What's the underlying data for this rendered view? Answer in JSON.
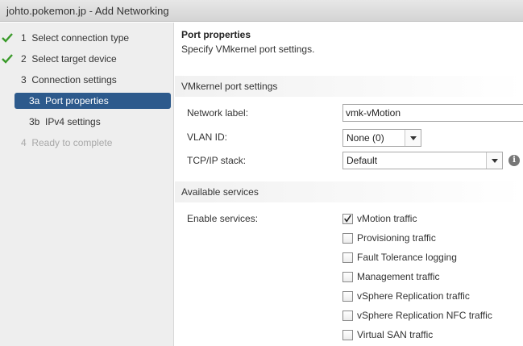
{
  "window": {
    "title": "johto.pokemon.jp - Add Networking"
  },
  "colors": {
    "active_step_bg": "#2d5a8c",
    "check_green": "#3a9a2a",
    "sidebar_bg": "#eeeeee"
  },
  "steps": [
    {
      "label": "1  Select connection type",
      "state": "completed",
      "icon": "check-icon"
    },
    {
      "label": "2  Select target device",
      "state": "completed",
      "icon": "check-icon"
    },
    {
      "label": "3  Connection settings",
      "state": "current"
    },
    {
      "label": "3a  Port properties",
      "state": "active"
    },
    {
      "label": "3b  IPv4 settings",
      "state": "normal"
    },
    {
      "label": "4  Ready to complete",
      "state": "disabled"
    }
  ],
  "page": {
    "title": "Port properties",
    "subtitle": "Specify VMkernel port settings."
  },
  "vmk_section": {
    "header": "VMkernel port settings",
    "network_label": {
      "label": "Network label:",
      "value": "vmk-vMotion"
    },
    "vlan_id": {
      "label": "VLAN ID:",
      "value": "None (0)"
    },
    "tcpip_stack": {
      "label": "TCP/IP stack:",
      "value": "Default",
      "info_icon": "info-icon"
    }
  },
  "services_section": {
    "header": "Available services",
    "label": "Enable services:",
    "services": [
      {
        "label": "vMotion traffic",
        "checked": true
      },
      {
        "label": "Provisioning traffic",
        "checked": false
      },
      {
        "label": "Fault Tolerance logging",
        "checked": false
      },
      {
        "label": "Management traffic",
        "checked": false
      },
      {
        "label": "vSphere Replication traffic",
        "checked": false
      },
      {
        "label": "vSphere Replication NFC traffic",
        "checked": false
      },
      {
        "label": "Virtual SAN traffic",
        "checked": false
      }
    ]
  }
}
